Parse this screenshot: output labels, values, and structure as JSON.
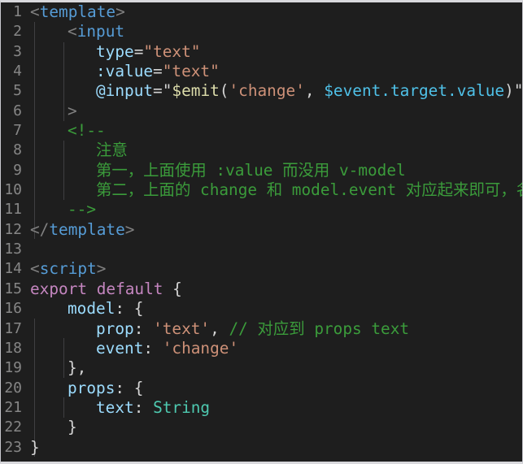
{
  "editor": {
    "theme": "dark-plus",
    "background": "#1e1e1e",
    "gutter_color": "#868686",
    "first_line": 1,
    "last_line": 23,
    "total_lines": 23,
    "language": "vue",
    "line_numbers": [
      "1",
      "2",
      "3",
      "4",
      "5",
      "6",
      "7",
      "8",
      "9",
      "10",
      "11",
      "12",
      "13",
      "14",
      "15",
      "16",
      "17",
      "18",
      "19",
      "20",
      "21",
      "22",
      "23"
    ],
    "colors": {
      "tag": "#569cd6",
      "bracket": "#808080",
      "attribute": "#9cdcfe",
      "string": "#ce9178",
      "function": "#dcdcaa",
      "comment": "#3b9c3b",
      "keyword": "#c586c0",
      "type": "#4ec9b0",
      "plain": "#d4d4d4",
      "variable": "#4fc1e8",
      "indent_guide": "#3f3f42"
    }
  },
  "lines": [
    {
      "n": "1",
      "text": "<template>"
    },
    {
      "n": "2",
      "text": "    <input"
    },
    {
      "n": "3",
      "text": "        type=\"text\""
    },
    {
      "n": "4",
      "text": "        :value=\"text\""
    },
    {
      "n": "5",
      "text": "        @input=\"$emit('change', $event.target.value)\""
    },
    {
      "n": "6",
      "text": "    >"
    },
    {
      "n": "7",
      "text": "    <!--"
    },
    {
      "n": "8",
      "text": "        注意"
    },
    {
      "n": "9",
      "text": "        第一，上面使用 :value 而没用 v-model"
    },
    {
      "n": "10",
      "text": "        第二，上面的 change 和 model.event 对应起来即可，名字自己改"
    },
    {
      "n": "11",
      "text": "    -->"
    },
    {
      "n": "12",
      "text": "</template>"
    },
    {
      "n": "13",
      "text": ""
    },
    {
      "n": "14",
      "text": "<script>"
    },
    {
      "n": "15",
      "text": "export default {"
    },
    {
      "n": "16",
      "text": "    model: {"
    },
    {
      "n": "17",
      "text": "        prop: 'text', // 对应到 props text"
    },
    {
      "n": "18",
      "text": "        event: 'change'"
    },
    {
      "n": "19",
      "text": "    },"
    },
    {
      "n": "20",
      "text": "    props: {"
    },
    {
      "n": "21",
      "text": "        text: String"
    },
    {
      "n": "22",
      "text": "    }"
    },
    {
      "n": "23",
      "text": "}"
    }
  ],
  "tokens": {
    "l1_lt": "<",
    "l1_tag": "template",
    "l1_gt": ">",
    "l2_lt": "<",
    "l2_tag": "input",
    "l3_attr": "type",
    "l3_eq": "=",
    "l3_val": "\"text\"",
    "l4_attr": ":value",
    "l4_eq": "=",
    "l4_val": "\"text\"",
    "l5_attr": "@input",
    "l5_eq": "=",
    "l5_q1": "\"",
    "l5_fn": "$emit",
    "l5_p1": "(",
    "l5_s1": "'change'",
    "l5_comma": ", ",
    "l5_var": "$event.target.value",
    "l5_p2": ")",
    "l5_q2": "\"",
    "l6_gt": ">",
    "l7_open": "<!--",
    "l8_c": "注意",
    "l9_c": "第一，上面使用 :value 而没用 v-model",
    "l10_c": "第二，上面的 change 和 model.event 对应起来即可，名字自己改",
    "l11_close": "-->",
    "l12_lt": "</",
    "l12_tag": "template",
    "l12_gt": ">",
    "l14_lt": "<",
    "l14_tag": "script",
    "l14_gt": ">",
    "l15_kw": "export default",
    "l15_brace": " {",
    "l16_prop": "model",
    "l16_rest": ": {",
    "l17_prop": "prop",
    "l17_colon": ": ",
    "l17_str": "'text'",
    "l17_comma": ", ",
    "l17_comment": "// 对应到 props text",
    "l18_prop": "event",
    "l18_colon": ": ",
    "l18_str": "'change'",
    "l19_t": "},",
    "l20_prop": "props",
    "l20_rest": ": {",
    "l21_prop": "text",
    "l21_colon": ": ",
    "l21_type": "String",
    "l22_t": "}",
    "l23_t": "}"
  }
}
